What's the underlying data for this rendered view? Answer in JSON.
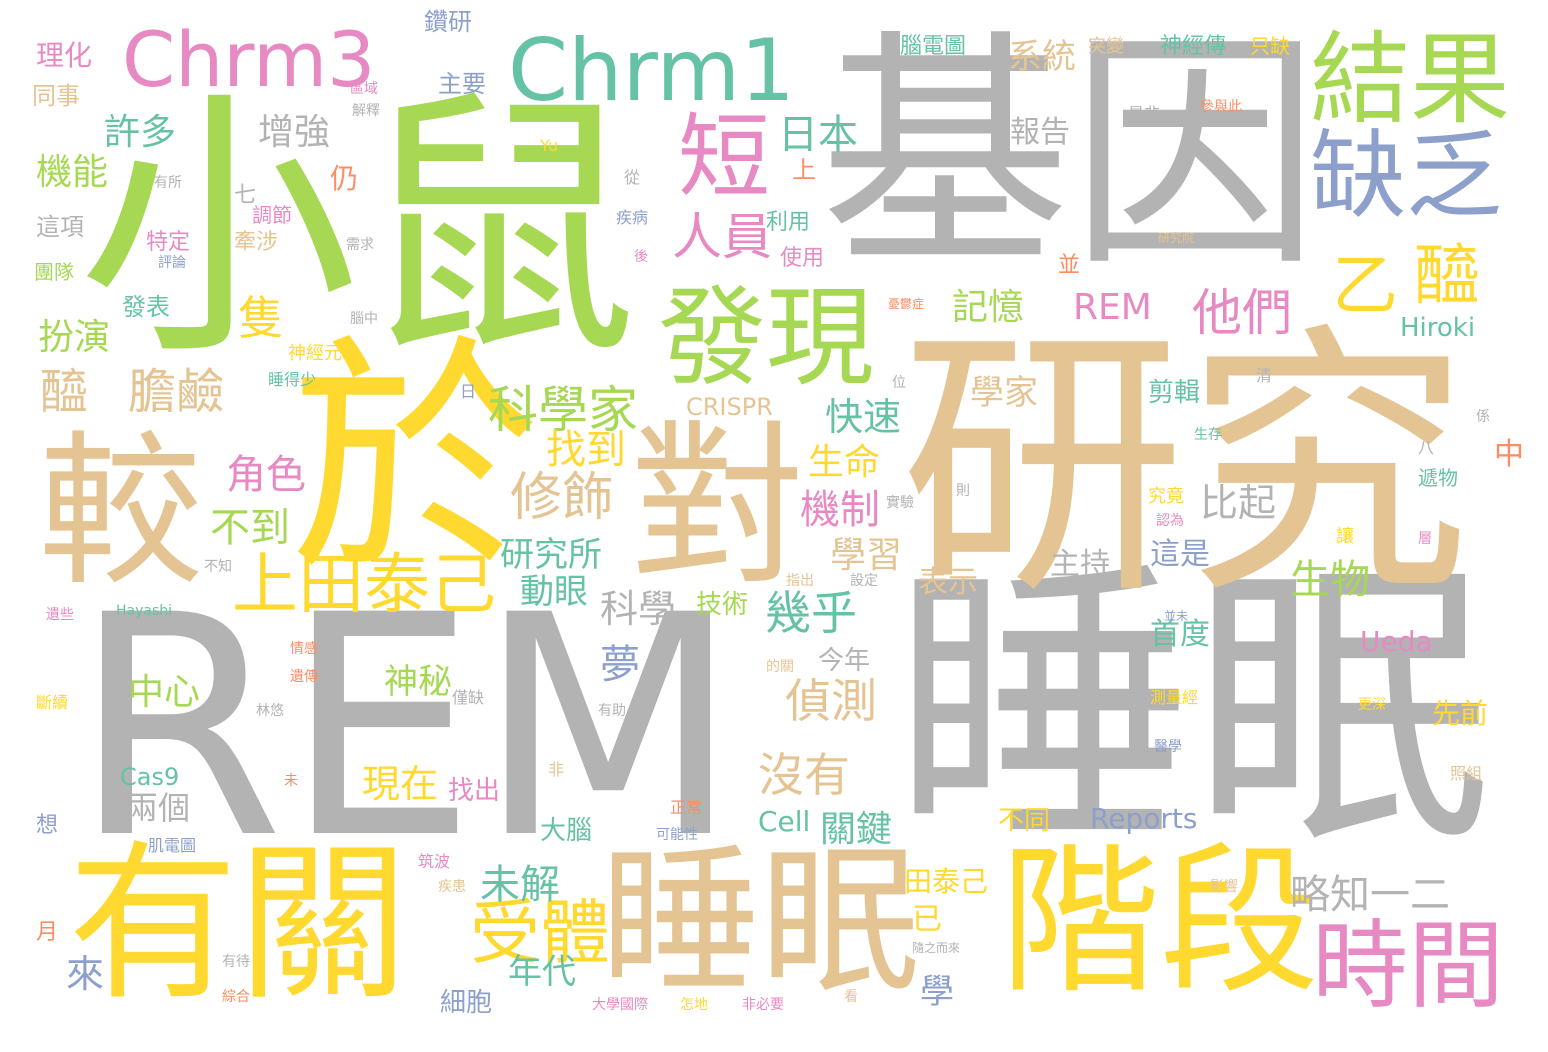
{
  "palette": {
    "gray": "#b3b3b3",
    "green": "#a6d854",
    "tan": "#e5c494",
    "yellow": "#ffd92f",
    "pink": "#e78ac3",
    "teal": "#66c2a5",
    "blue": "#8da0cb",
    "orange": "#fc8d62"
  },
  "words": [
    {
      "text": "REM",
      "color": "gray",
      "orient": "h"
    },
    {
      "text": "睡眠",
      "color": "gray",
      "orient": "h"
    },
    {
      "text": "基因",
      "color": "gray",
      "orient": "h"
    },
    {
      "text": "研究",
      "color": "tan",
      "orient": "h"
    },
    {
      "text": "小鼠",
      "color": "green",
      "orient": "h"
    },
    {
      "text": "於",
      "color": "yellow",
      "orient": "h"
    },
    {
      "text": "較",
      "color": "tan",
      "orient": "h"
    },
    {
      "text": "對",
      "color": "tan",
      "orient": "h"
    },
    {
      "text": "有關",
      "color": "yellow",
      "orient": "h"
    },
    {
      "text": "睡眠",
      "color": "tan",
      "orient": "h"
    },
    {
      "text": "階段",
      "color": "yellow",
      "orient": "h"
    },
    {
      "text": "Chrm1",
      "color": "teal",
      "orient": "h"
    },
    {
      "text": "Chrm3",
      "color": "pink",
      "orient": "h"
    },
    {
      "text": "發現",
      "color": "green",
      "orient": "h"
    },
    {
      "text": "結果",
      "color": "green",
      "orient": "h"
    },
    {
      "text": "缺乏",
      "color": "blue",
      "orient": "h"
    },
    {
      "text": "時間",
      "color": "pink",
      "orient": "h"
    },
    {
      "text": "短",
      "color": "pink",
      "orient": "h"
    },
    {
      "text": "乙",
      "color": "yellow",
      "orient": "h"
    },
    {
      "text": "醯",
      "color": "yellow",
      "orient": "h"
    },
    {
      "text": "上田泰己",
      "color": "yellow",
      "orient": "h"
    },
    {
      "text": "受體",
      "color": "yellow",
      "orient": "h"
    },
    {
      "text": "人員",
      "color": "pink",
      "orient": "h"
    },
    {
      "text": "他們",
      "color": "pink",
      "orient": "h"
    },
    {
      "text": "科學家",
      "color": "green",
      "orient": "h"
    },
    {
      "text": "修飾",
      "color": "tan",
      "orient": "h"
    },
    {
      "text": "醯",
      "color": "tan",
      "orient": "h"
    },
    {
      "text": "膽鹼",
      "color": "tan",
      "orient": "h"
    },
    {
      "text": "REM",
      "color": "pink",
      "orient": "h"
    },
    {
      "text": "隻",
      "color": "yellow",
      "orient": "h"
    },
    {
      "text": "日本",
      "color": "teal",
      "orient": "h"
    },
    {
      "text": "記憶",
      "color": "green",
      "orient": "h"
    },
    {
      "text": "許多",
      "color": "teal",
      "orient": "h"
    },
    {
      "text": "增強",
      "color": "gray",
      "orient": "h"
    },
    {
      "text": "系統",
      "color": "tan",
      "orient": "h"
    },
    {
      "text": "機能",
      "color": "green",
      "orient": "h"
    },
    {
      "text": "扮演",
      "color": "green",
      "orient": "h"
    },
    {
      "text": "角色",
      "color": "pink",
      "orient": "h"
    },
    {
      "text": "不到",
      "color": "green",
      "orient": "h"
    },
    {
      "text": "找到",
      "color": "yellow",
      "orient": "h"
    },
    {
      "text": "生命",
      "color": "yellow",
      "orient": "h"
    },
    {
      "text": "快速",
      "color": "teal",
      "orient": "h"
    },
    {
      "text": "機制",
      "color": "pink",
      "orient": "h"
    },
    {
      "text": "學習",
      "color": "tan",
      "orient": "h"
    },
    {
      "text": "研究所",
      "color": "teal",
      "orient": "h"
    },
    {
      "text": "比起",
      "color": "gray",
      "orient": "h"
    },
    {
      "text": "學家",
      "color": "tan",
      "orient": "h"
    },
    {
      "text": "科學",
      "color": "gray",
      "orient": "h"
    },
    {
      "text": "動眼",
      "color": "teal",
      "orient": "h"
    },
    {
      "text": "幾乎",
      "color": "teal",
      "orient": "h"
    },
    {
      "text": "夢",
      "color": "blue",
      "orient": "h"
    },
    {
      "text": "偵測",
      "color": "tan",
      "orient": "h"
    },
    {
      "text": "中心",
      "color": "green",
      "orient": "h"
    },
    {
      "text": "神秘",
      "color": "green",
      "orient": "h"
    },
    {
      "text": "沒有",
      "color": "tan",
      "orient": "h"
    },
    {
      "text": "現在",
      "color": "yellow",
      "orient": "h"
    },
    {
      "text": "兩個",
      "color": "gray",
      "orient": "h"
    },
    {
      "text": "關鍵",
      "color": "teal",
      "orient": "h"
    },
    {
      "text": "未解",
      "color": "teal",
      "orient": "h"
    },
    {
      "text": "年代",
      "color": "teal",
      "orient": "h"
    },
    {
      "text": "來",
      "color": "blue",
      "orient": "h"
    },
    {
      "text": "學",
      "color": "blue",
      "orient": "h"
    },
    {
      "text": "略知一二",
      "color": "gray",
      "orient": "h"
    },
    {
      "text": "生物",
      "color": "green",
      "orient": "h"
    },
    {
      "text": "主持",
      "color": "gray",
      "orient": "h"
    },
    {
      "text": "表示",
      "color": "tan",
      "orient": "h"
    },
    {
      "text": "這是",
      "color": "blue",
      "orient": "h"
    },
    {
      "text": "首度",
      "color": "teal",
      "orient": "h"
    },
    {
      "text": "先前",
      "color": "yellow",
      "orient": "h"
    },
    {
      "text": "不同",
      "color": "yellow",
      "orient": "h"
    },
    {
      "text": "報告",
      "color": "gray",
      "orient": "h"
    },
    {
      "text": "剪輯",
      "color": "teal",
      "orient": "h"
    },
    {
      "text": "Hiroki",
      "color": "teal",
      "orient": "h"
    },
    {
      "text": "Ueda",
      "color": "pink",
      "orient": "h"
    },
    {
      "text": "Reports",
      "color": "blue",
      "orient": "h"
    },
    {
      "text": "Cell",
      "color": "teal",
      "orient": "h"
    },
    {
      "text": "CRISPR",
      "color": "tan",
      "orient": "h"
    },
    {
      "text": "Cas9",
      "color": "teal",
      "orient": "h"
    },
    {
      "text": "今年",
      "color": "gray",
      "orient": "h"
    },
    {
      "text": "技術",
      "color": "green",
      "orient": "h"
    },
    {
      "text": "找出",
      "color": "pink",
      "orient": "h"
    },
    {
      "text": "大腦",
      "color": "teal",
      "orient": "h"
    },
    {
      "text": "細胞",
      "color": "blue",
      "orient": "h"
    },
    {
      "text": "田泰己",
      "color": "yellow",
      "orient": "h"
    },
    {
      "text": "已",
      "color": "yellow",
      "orient": "h"
    },
    {
      "text": "中",
      "color": "orange",
      "orient": "h"
    },
    {
      "text": "理化",
      "color": "pink",
      "orient": "h"
    },
    {
      "text": "同事",
      "color": "tan",
      "orient": "h"
    },
    {
      "text": "鑽研",
      "color": "blue",
      "orient": "h"
    },
    {
      "text": "主要",
      "color": "blue",
      "orient": "h"
    },
    {
      "text": "腦電圖",
      "color": "teal",
      "orient": "h"
    },
    {
      "text": "神經傳",
      "color": "teal",
      "orient": "h"
    },
    {
      "text": "只缺",
      "color": "yellow",
      "orient": "h"
    },
    {
      "text": "突變",
      "color": "tan",
      "orient": "h"
    },
    {
      "text": "這項",
      "color": "gray",
      "orient": "h"
    },
    {
      "text": "特定",
      "color": "pink",
      "orient": "h"
    },
    {
      "text": "團隊",
      "color": "green",
      "orient": "h"
    },
    {
      "text": "發表",
      "color": "teal",
      "orient": "h"
    },
    {
      "text": "牽涉",
      "color": "tan",
      "orient": "h"
    },
    {
      "text": "調節",
      "color": "pink",
      "orient": "h"
    },
    {
      "text": "仍",
      "color": "orange",
      "orient": "h"
    },
    {
      "text": "七",
      "color": "gray",
      "orient": "h"
    },
    {
      "text": "上",
      "color": "orange",
      "orient": "h"
    },
    {
      "text": "利用",
      "color": "teal",
      "orient": "h"
    },
    {
      "text": "使用",
      "color": "pink",
      "orient": "h"
    },
    {
      "text": "並",
      "color": "orange",
      "orient": "h"
    },
    {
      "text": "神經元",
      "color": "yellow",
      "orient": "h"
    },
    {
      "text": "睡得少",
      "color": "teal",
      "orient": "h"
    },
    {
      "text": "Yu",
      "color": "yellow",
      "orient": "h"
    },
    {
      "text": "有所",
      "color": "gray",
      "orient": "h"
    },
    {
      "text": "區域",
      "color": "pink",
      "orient": "h"
    },
    {
      "text": "解釋",
      "color": "gray",
      "orient": "h"
    },
    {
      "text": "是非",
      "color": "gray",
      "orient": "h"
    },
    {
      "text": "參與此",
      "color": "orange",
      "orient": "h"
    },
    {
      "text": "研究院",
      "color": "tan",
      "orient": "h"
    },
    {
      "text": "疾病",
      "color": "blue",
      "orient": "h"
    },
    {
      "text": "從",
      "color": "gray",
      "orient": "h"
    },
    {
      "text": "後",
      "color": "pink",
      "orient": "h"
    },
    {
      "text": "評論",
      "color": "blue",
      "orient": "h"
    },
    {
      "text": "需求",
      "color": "gray",
      "orient": "h"
    },
    {
      "text": "腦中",
      "color": "gray",
      "orient": "h"
    },
    {
      "text": "憂鬱症",
      "color": "orange",
      "orient": "h"
    },
    {
      "text": "位",
      "color": "gray",
      "orient": "h"
    },
    {
      "text": "日",
      "color": "blue",
      "orient": "h"
    },
    {
      "text": "清",
      "color": "gray",
      "orient": "h"
    },
    {
      "text": "生存",
      "color": "teal",
      "orient": "h"
    },
    {
      "text": "八",
      "color": "gray",
      "orient": "h"
    },
    {
      "text": "遞物",
      "color": "teal",
      "orient": "h"
    },
    {
      "text": "係",
      "color": "gray",
      "orient": "h"
    },
    {
      "text": "究竟",
      "color": "yellow",
      "orient": "h"
    },
    {
      "text": "認為",
      "color": "pink",
      "orient": "h"
    },
    {
      "text": "讓",
      "color": "yellow",
      "orient": "h"
    },
    {
      "text": "層",
      "color": "pink",
      "orient": "h"
    },
    {
      "text": "實驗",
      "color": "gray",
      "orient": "h"
    },
    {
      "text": "則",
      "color": "gray",
      "orient": "h"
    },
    {
      "text": "指出",
      "color": "tan",
      "orient": "h"
    },
    {
      "text": "設定",
      "color": "gray",
      "orient": "h"
    },
    {
      "text": "不知",
      "color": "gray",
      "orient": "h"
    },
    {
      "text": "遺些",
      "color": "pink",
      "orient": "h"
    },
    {
      "text": "Hayashi",
      "color": "teal",
      "orient": "h"
    },
    {
      "text": "並未",
      "color": "blue",
      "orient": "h"
    },
    {
      "text": "情感",
      "color": "orange",
      "orient": "h"
    },
    {
      "text": "遺傳",
      "color": "orange",
      "orient": "h"
    },
    {
      "text": "的關",
      "color": "tan",
      "orient": "h"
    },
    {
      "text": "測量經",
      "color": "yellow",
      "orient": "h"
    },
    {
      "text": "更深",
      "color": "yellow",
      "orient": "h"
    },
    {
      "text": "斷續",
      "color": "yellow",
      "orient": "h"
    },
    {
      "text": "林悠",
      "color": "gray",
      "orient": "h"
    },
    {
      "text": "僅缺",
      "color": "gray",
      "orient": "h"
    },
    {
      "text": "有助",
      "color": "gray",
      "orient": "h"
    },
    {
      "text": "醫學",
      "color": "blue",
      "orient": "h"
    },
    {
      "text": "照組",
      "color": "tan",
      "orient": "h"
    },
    {
      "text": "非",
      "color": "tan",
      "orient": "h"
    },
    {
      "text": "未",
      "color": "orange",
      "orient": "h"
    },
    {
      "text": "正常",
      "color": "orange",
      "orient": "h"
    },
    {
      "text": "可能性",
      "color": "blue",
      "orient": "h"
    },
    {
      "text": "想",
      "color": "blue",
      "orient": "h"
    },
    {
      "text": "肌電圖",
      "color": "blue",
      "orient": "h"
    },
    {
      "text": "筑波",
      "color": "pink",
      "orient": "h"
    },
    {
      "text": "疾患",
      "color": "tan",
      "orient": "h"
    },
    {
      "text": "影響",
      "color": "tan",
      "orient": "h"
    },
    {
      "text": "月",
      "color": "orange",
      "orient": "h"
    },
    {
      "text": "隨之而來",
      "color": "gray",
      "orient": "h"
    },
    {
      "text": "有待",
      "color": "gray",
      "orient": "h"
    },
    {
      "text": "綜合",
      "color": "orange",
      "orient": "h"
    },
    {
      "text": "大學國際",
      "color": "pink",
      "orient": "h"
    },
    {
      "text": "怎地",
      "color": "yellow",
      "orient": "h"
    },
    {
      "text": "非必要",
      "color": "pink",
      "orient": "h"
    },
    {
      "text": "看",
      "color": "tan",
      "orient": "h"
    }
  ]
}
